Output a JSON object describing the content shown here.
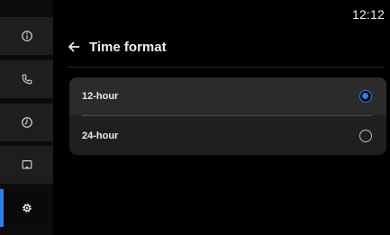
{
  "status_bar": {
    "time": "12:12"
  },
  "sidebar": {
    "items": [
      {
        "icon": "info-icon",
        "active": false
      },
      {
        "icon": "phone-icon",
        "active": false
      },
      {
        "icon": "clock-icon",
        "active": false
      },
      {
        "icon": "screen-cast-icon",
        "active": false
      },
      {
        "icon": "gear-icon",
        "active": true
      }
    ],
    "accent_color": "#2e7cf0"
  },
  "header": {
    "back_icon": "arrow-left-icon",
    "title": "Time format"
  },
  "time_format": {
    "options": [
      {
        "label": "12-hour",
        "selected": true
      },
      {
        "label": "24-hour",
        "selected": false
      }
    ]
  }
}
